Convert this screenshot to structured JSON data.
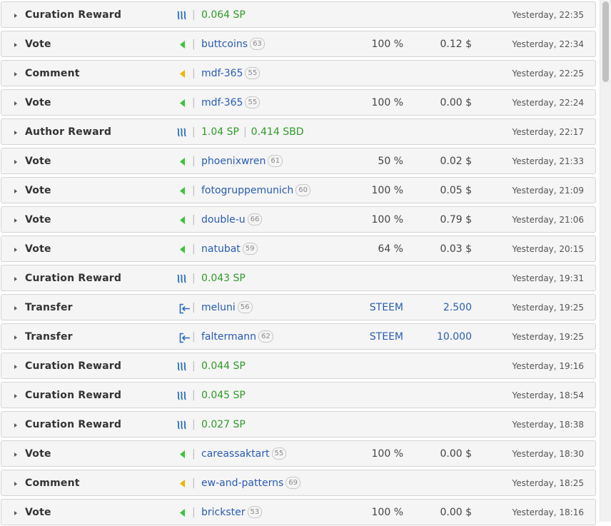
{
  "colors": {
    "row_bg": "#f5f5f5",
    "row_border": "#d4d4d4",
    "type_text": "#333333",
    "value_green": "#2e9a28",
    "link_blue": "#2a5cb0",
    "vote_arrow": "#3cc43c",
    "comment_arrow": "#f0b400",
    "steem_icon": "#2a6bc0"
  },
  "rows": [
    {
      "type": "Curation Reward",
      "icon": "steem-icon",
      "amount_sp": "0.064 SP",
      "time": "Yesterday, 22:35"
    },
    {
      "type": "Vote",
      "icon": "vote-arrow-icon",
      "user": "buttcoins",
      "rep": "63",
      "percent": "100 %",
      "value": "0.12 $",
      "time": "Yesterday, 22:34"
    },
    {
      "type": "Comment",
      "icon": "comment-arrow-icon",
      "user": "mdf-365",
      "rep": "55",
      "time": "Yesterday, 22:25"
    },
    {
      "type": "Vote",
      "icon": "vote-arrow-icon",
      "user": "mdf-365",
      "rep": "55",
      "percent": "100 %",
      "value": "0.00 $",
      "time": "Yesterday, 22:24"
    },
    {
      "type": "Author Reward",
      "icon": "steem-icon",
      "amount_sp": "1.04 SP",
      "amount_sbd": "0.414 SBD",
      "time": "Yesterday, 22:17"
    },
    {
      "type": "Vote",
      "icon": "vote-arrow-icon",
      "user": "phoenixwren",
      "rep": "61",
      "percent": "50 %",
      "value": "0.02 $",
      "time": "Yesterday, 21:33"
    },
    {
      "type": "Vote",
      "icon": "vote-arrow-icon",
      "user": "fotogruppemunich",
      "rep": "60",
      "percent": "100 %",
      "value": "0.05 $",
      "time": "Yesterday, 21:09"
    },
    {
      "type": "Vote",
      "icon": "vote-arrow-icon",
      "user": "double-u",
      "rep": "66",
      "percent": "100 %",
      "value": "0.79 $",
      "time": "Yesterday, 21:06"
    },
    {
      "type": "Vote",
      "icon": "vote-arrow-icon",
      "user": "natubat",
      "rep": "59",
      "percent": "64 %",
      "value": "0.03 $",
      "time": "Yesterday, 20:15"
    },
    {
      "type": "Curation Reward",
      "icon": "steem-icon",
      "amount_sp": "0.043 SP",
      "time": "Yesterday, 19:31"
    },
    {
      "type": "Transfer",
      "icon": "transfer-in-icon",
      "user": "meluni",
      "rep": "56",
      "currency": "STEEM",
      "amount": "2.500",
      "time": "Yesterday, 19:25"
    },
    {
      "type": "Transfer",
      "icon": "transfer-in-icon",
      "user": "faltermann",
      "rep": "62",
      "currency": "STEEM",
      "amount": "10.000",
      "time": "Yesterday, 19:25"
    },
    {
      "type": "Curation Reward",
      "icon": "steem-icon",
      "amount_sp": "0.044 SP",
      "time": "Yesterday, 19:16"
    },
    {
      "type": "Curation Reward",
      "icon": "steem-icon",
      "amount_sp": "0.045 SP",
      "time": "Yesterday, 18:54"
    },
    {
      "type": "Curation Reward",
      "icon": "steem-icon",
      "amount_sp": "0.027 SP",
      "time": "Yesterday, 18:38"
    },
    {
      "type": "Vote",
      "icon": "vote-arrow-icon",
      "user": "careassaktart",
      "rep": "55",
      "percent": "100 %",
      "value": "0.00 $",
      "time": "Yesterday, 18:30"
    },
    {
      "type": "Comment",
      "icon": "comment-arrow-icon",
      "user": "ew-and-patterns",
      "rep": "69",
      "time": "Yesterday, 18:25"
    },
    {
      "type": "Vote",
      "icon": "vote-arrow-icon",
      "user": "brickster",
      "rep": "53",
      "percent": "100 %",
      "value": "0.00 $",
      "time": "Yesterday, 18:16"
    }
  ]
}
